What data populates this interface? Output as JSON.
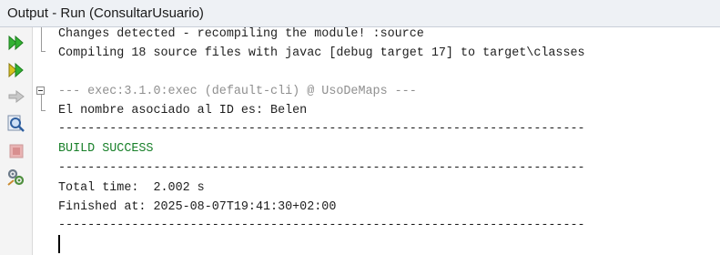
{
  "window": {
    "title": "Output - Run (ConsultarUsuario)"
  },
  "toolbar": {
    "buttons": [
      {
        "icon": "rerun-icon",
        "color": "#2fa52f"
      },
      {
        "icon": "rerun-with-options-icon",
        "color": "#2fa52f"
      },
      {
        "icon": "arrow-right-icon",
        "color": "#b9b9b9"
      },
      {
        "icon": "settings-search-icon",
        "color": "#3b6fb6"
      },
      {
        "icon": "stop-icon",
        "color": "#d99a9a"
      },
      {
        "icon": "tools-icon",
        "color": "#6c7a89"
      }
    ]
  },
  "output": {
    "lines": [
      "Changes detected - recompiling the module! :source",
      "Compiling 18 source files with javac [debug target 17] to target\\classes",
      "--- exec:3.1.0:exec (default-cli) @ UsoDeMaps ---",
      "El nombre asociado al ID es: Belen",
      "------------------------------------------------------------------------",
      "BUILD SUCCESS",
      "------------------------------------------------------------------------",
      "Total time:  2.002 s",
      "Finished at: 2025-08-07T19:41:30+02:00",
      "------------------------------------------------------------------------"
    ]
  },
  "colors": {
    "success": "#19802a",
    "muted": "#8f8f8f",
    "text": "#1e1e1e"
  }
}
